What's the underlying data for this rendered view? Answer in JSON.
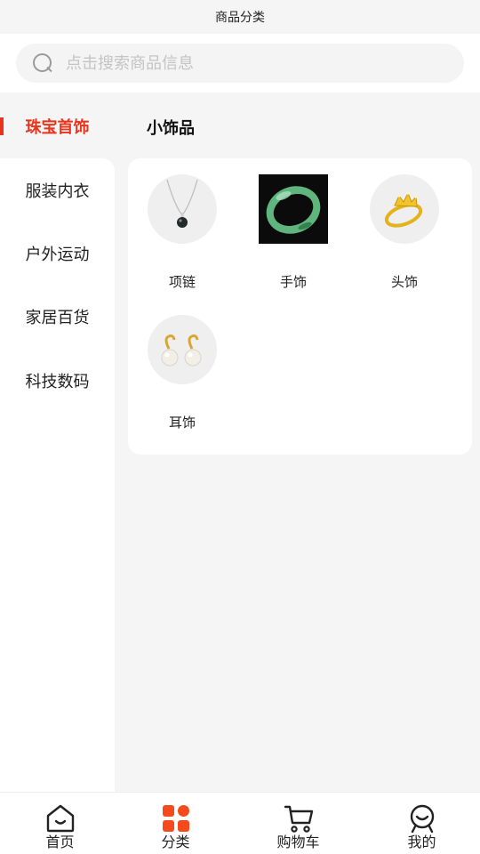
{
  "header": {
    "title": "商品分类"
  },
  "search": {
    "placeholder": "点击搜索商品信息",
    "icon": "search-icon"
  },
  "sidebar": {
    "items": [
      {
        "label": "珠宝首饰",
        "active": true
      },
      {
        "label": "服装内衣",
        "active": false
      },
      {
        "label": "户外运动",
        "active": false
      },
      {
        "label": "家居百货",
        "active": false
      },
      {
        "label": "科技数码",
        "active": false
      }
    ]
  },
  "main": {
    "section_title": "小饰品",
    "items": [
      {
        "label": "项链",
        "icon": "necklace-image"
      },
      {
        "label": "手饰",
        "icon": "jade-bangle-image"
      },
      {
        "label": "头饰",
        "icon": "crown-ring-image"
      },
      {
        "label": "耳饰",
        "icon": "pearl-earrings-image"
      }
    ]
  },
  "tabbar": {
    "tabs": [
      {
        "label": "首页",
        "icon": "home-icon"
      },
      {
        "label": "分类",
        "icon": "category-icon",
        "active": true
      },
      {
        "label": "购物车",
        "icon": "cart-icon"
      },
      {
        "label": "我的",
        "icon": "profile-icon"
      }
    ]
  },
  "colors": {
    "accent": "#e8341c",
    "category_icon": "#f44a1d"
  }
}
